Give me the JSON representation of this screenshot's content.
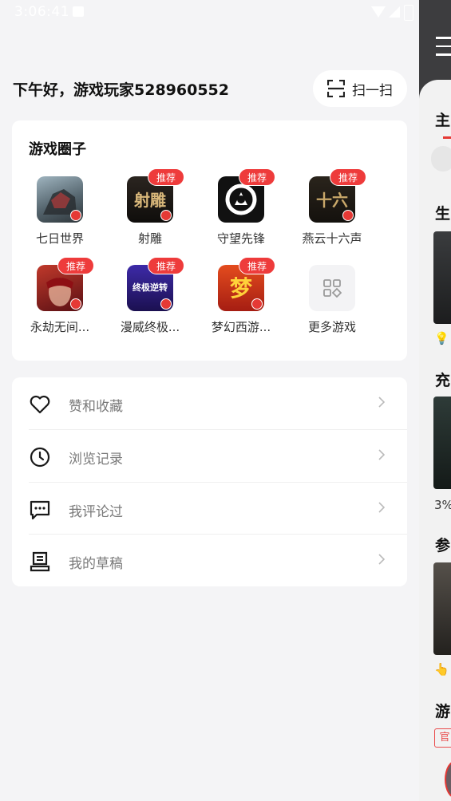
{
  "status_bar": {
    "time": "3:06:41"
  },
  "header": {
    "greeting": "下午好，游戏玩家528960552",
    "scan_label": "扫一扫"
  },
  "game_circle": {
    "title": "游戏圈子",
    "badge_text": "推荐",
    "games": [
      {
        "name": "七日世界",
        "icon_text": "",
        "recommended": false,
        "bg": "#5a6a74"
      },
      {
        "name": "射雕",
        "icon_text": "射雕",
        "recommended": true,
        "bg": "#1d1a17"
      },
      {
        "name": "守望先锋",
        "icon_text": "",
        "recommended": true,
        "bg": "#111111"
      },
      {
        "name": "燕云十六声",
        "icon_text": "十六",
        "recommended": true,
        "bg": "#1f1a14"
      },
      {
        "name": "永劫无间...",
        "icon_text": "",
        "recommended": true,
        "bg": "#7a1c20"
      },
      {
        "name": "漫威终极...",
        "icon_text": "终极逆转",
        "recommended": true,
        "bg": "#2a1c6e"
      },
      {
        "name": "梦幻西游...",
        "icon_text": "梦",
        "recommended": true,
        "bg": "#c43a1a"
      },
      {
        "name": "更多游戏",
        "icon_text": "",
        "recommended": false,
        "bg": "#f3f3f5"
      }
    ]
  },
  "menu": {
    "items": [
      {
        "label": "赞和收藏",
        "icon": "heart-icon"
      },
      {
        "label": "浏览记录",
        "icon": "clock-icon"
      },
      {
        "label": "我评论过",
        "icon": "comment-icon"
      },
      {
        "label": "我的草稿",
        "icon": "draft-icon"
      }
    ]
  },
  "side_panel": {
    "tab_partial": "主",
    "section1": "生",
    "section2": "充",
    "percent": "3%",
    "section3": "参",
    "section4": "游",
    "tag": "官"
  }
}
